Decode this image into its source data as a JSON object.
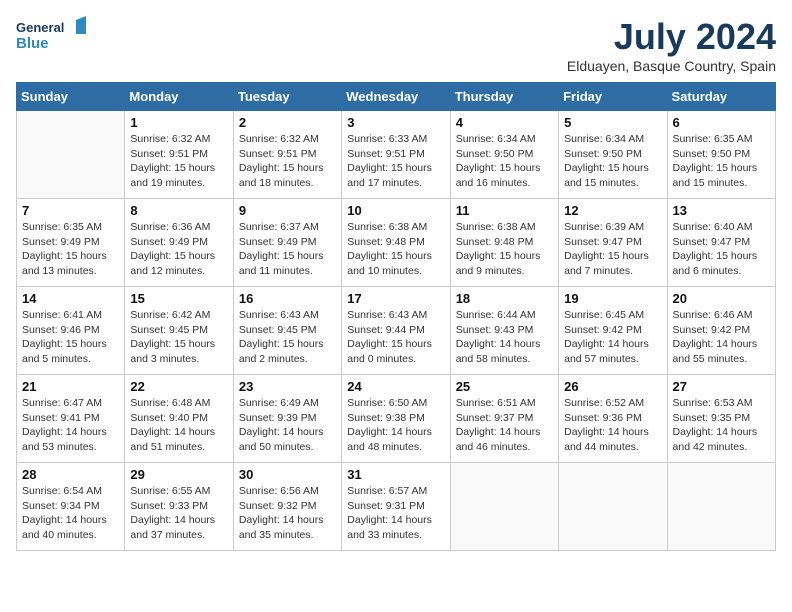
{
  "header": {
    "logo_line1": "General",
    "logo_line2": "Blue",
    "month_year": "July 2024",
    "location": "Elduayen, Basque Country, Spain"
  },
  "weekdays": [
    "Sunday",
    "Monday",
    "Tuesday",
    "Wednesday",
    "Thursday",
    "Friday",
    "Saturday"
  ],
  "weeks": [
    [
      {
        "day": "",
        "info": ""
      },
      {
        "day": "1",
        "info": "Sunrise: 6:32 AM\nSunset: 9:51 PM\nDaylight: 15 hours\nand 19 minutes."
      },
      {
        "day": "2",
        "info": "Sunrise: 6:32 AM\nSunset: 9:51 PM\nDaylight: 15 hours\nand 18 minutes."
      },
      {
        "day": "3",
        "info": "Sunrise: 6:33 AM\nSunset: 9:51 PM\nDaylight: 15 hours\nand 17 minutes."
      },
      {
        "day": "4",
        "info": "Sunrise: 6:34 AM\nSunset: 9:50 PM\nDaylight: 15 hours\nand 16 minutes."
      },
      {
        "day": "5",
        "info": "Sunrise: 6:34 AM\nSunset: 9:50 PM\nDaylight: 15 hours\nand 15 minutes."
      },
      {
        "day": "6",
        "info": "Sunrise: 6:35 AM\nSunset: 9:50 PM\nDaylight: 15 hours\nand 15 minutes."
      }
    ],
    [
      {
        "day": "7",
        "info": "Sunrise: 6:35 AM\nSunset: 9:49 PM\nDaylight: 15 hours\nand 13 minutes."
      },
      {
        "day": "8",
        "info": "Sunrise: 6:36 AM\nSunset: 9:49 PM\nDaylight: 15 hours\nand 12 minutes."
      },
      {
        "day": "9",
        "info": "Sunrise: 6:37 AM\nSunset: 9:49 PM\nDaylight: 15 hours\nand 11 minutes."
      },
      {
        "day": "10",
        "info": "Sunrise: 6:38 AM\nSunset: 9:48 PM\nDaylight: 15 hours\nand 10 minutes."
      },
      {
        "day": "11",
        "info": "Sunrise: 6:38 AM\nSunset: 9:48 PM\nDaylight: 15 hours\nand 9 minutes."
      },
      {
        "day": "12",
        "info": "Sunrise: 6:39 AM\nSunset: 9:47 PM\nDaylight: 15 hours\nand 7 minutes."
      },
      {
        "day": "13",
        "info": "Sunrise: 6:40 AM\nSunset: 9:47 PM\nDaylight: 15 hours\nand 6 minutes."
      }
    ],
    [
      {
        "day": "14",
        "info": "Sunrise: 6:41 AM\nSunset: 9:46 PM\nDaylight: 15 hours\nand 5 minutes."
      },
      {
        "day": "15",
        "info": "Sunrise: 6:42 AM\nSunset: 9:45 PM\nDaylight: 15 hours\nand 3 minutes."
      },
      {
        "day": "16",
        "info": "Sunrise: 6:43 AM\nSunset: 9:45 PM\nDaylight: 15 hours\nand 2 minutes."
      },
      {
        "day": "17",
        "info": "Sunrise: 6:43 AM\nSunset: 9:44 PM\nDaylight: 15 hours\nand 0 minutes."
      },
      {
        "day": "18",
        "info": "Sunrise: 6:44 AM\nSunset: 9:43 PM\nDaylight: 14 hours\nand 58 minutes."
      },
      {
        "day": "19",
        "info": "Sunrise: 6:45 AM\nSunset: 9:42 PM\nDaylight: 14 hours\nand 57 minutes."
      },
      {
        "day": "20",
        "info": "Sunrise: 6:46 AM\nSunset: 9:42 PM\nDaylight: 14 hours\nand 55 minutes."
      }
    ],
    [
      {
        "day": "21",
        "info": "Sunrise: 6:47 AM\nSunset: 9:41 PM\nDaylight: 14 hours\nand 53 minutes."
      },
      {
        "day": "22",
        "info": "Sunrise: 6:48 AM\nSunset: 9:40 PM\nDaylight: 14 hours\nand 51 minutes."
      },
      {
        "day": "23",
        "info": "Sunrise: 6:49 AM\nSunset: 9:39 PM\nDaylight: 14 hours\nand 50 minutes."
      },
      {
        "day": "24",
        "info": "Sunrise: 6:50 AM\nSunset: 9:38 PM\nDaylight: 14 hours\nand 48 minutes."
      },
      {
        "day": "25",
        "info": "Sunrise: 6:51 AM\nSunset: 9:37 PM\nDaylight: 14 hours\nand 46 minutes."
      },
      {
        "day": "26",
        "info": "Sunrise: 6:52 AM\nSunset: 9:36 PM\nDaylight: 14 hours\nand 44 minutes."
      },
      {
        "day": "27",
        "info": "Sunrise: 6:53 AM\nSunset: 9:35 PM\nDaylight: 14 hours\nand 42 minutes."
      }
    ],
    [
      {
        "day": "28",
        "info": "Sunrise: 6:54 AM\nSunset: 9:34 PM\nDaylight: 14 hours\nand 40 minutes."
      },
      {
        "day": "29",
        "info": "Sunrise: 6:55 AM\nSunset: 9:33 PM\nDaylight: 14 hours\nand 37 minutes."
      },
      {
        "day": "30",
        "info": "Sunrise: 6:56 AM\nSunset: 9:32 PM\nDaylight: 14 hours\nand 35 minutes."
      },
      {
        "day": "31",
        "info": "Sunrise: 6:57 AM\nSunset: 9:31 PM\nDaylight: 14 hours\nand 33 minutes."
      },
      {
        "day": "",
        "info": ""
      },
      {
        "day": "",
        "info": ""
      },
      {
        "day": "",
        "info": ""
      }
    ]
  ]
}
